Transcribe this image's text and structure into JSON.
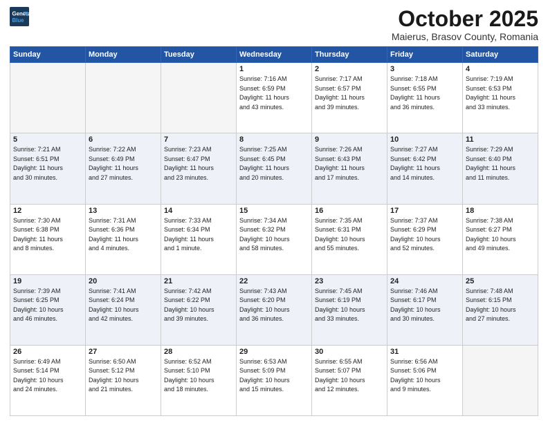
{
  "header": {
    "logo_line1": "General",
    "logo_line2": "Blue",
    "month": "October 2025",
    "location": "Maierus, Brasov County, Romania"
  },
  "weekdays": [
    "Sunday",
    "Monday",
    "Tuesday",
    "Wednesday",
    "Thursday",
    "Friday",
    "Saturday"
  ],
  "weeks": [
    [
      {
        "day": "",
        "info": ""
      },
      {
        "day": "",
        "info": ""
      },
      {
        "day": "",
        "info": ""
      },
      {
        "day": "1",
        "info": "Sunrise: 7:16 AM\nSunset: 6:59 PM\nDaylight: 11 hours\nand 43 minutes."
      },
      {
        "day": "2",
        "info": "Sunrise: 7:17 AM\nSunset: 6:57 PM\nDaylight: 11 hours\nand 39 minutes."
      },
      {
        "day": "3",
        "info": "Sunrise: 7:18 AM\nSunset: 6:55 PM\nDaylight: 11 hours\nand 36 minutes."
      },
      {
        "day": "4",
        "info": "Sunrise: 7:19 AM\nSunset: 6:53 PM\nDaylight: 11 hours\nand 33 minutes."
      }
    ],
    [
      {
        "day": "5",
        "info": "Sunrise: 7:21 AM\nSunset: 6:51 PM\nDaylight: 11 hours\nand 30 minutes."
      },
      {
        "day": "6",
        "info": "Sunrise: 7:22 AM\nSunset: 6:49 PM\nDaylight: 11 hours\nand 27 minutes."
      },
      {
        "day": "7",
        "info": "Sunrise: 7:23 AM\nSunset: 6:47 PM\nDaylight: 11 hours\nand 23 minutes."
      },
      {
        "day": "8",
        "info": "Sunrise: 7:25 AM\nSunset: 6:45 PM\nDaylight: 11 hours\nand 20 minutes."
      },
      {
        "day": "9",
        "info": "Sunrise: 7:26 AM\nSunset: 6:43 PM\nDaylight: 11 hours\nand 17 minutes."
      },
      {
        "day": "10",
        "info": "Sunrise: 7:27 AM\nSunset: 6:42 PM\nDaylight: 11 hours\nand 14 minutes."
      },
      {
        "day": "11",
        "info": "Sunrise: 7:29 AM\nSunset: 6:40 PM\nDaylight: 11 hours\nand 11 minutes."
      }
    ],
    [
      {
        "day": "12",
        "info": "Sunrise: 7:30 AM\nSunset: 6:38 PM\nDaylight: 11 hours\nand 8 minutes."
      },
      {
        "day": "13",
        "info": "Sunrise: 7:31 AM\nSunset: 6:36 PM\nDaylight: 11 hours\nand 4 minutes."
      },
      {
        "day": "14",
        "info": "Sunrise: 7:33 AM\nSunset: 6:34 PM\nDaylight: 11 hours\nand 1 minute."
      },
      {
        "day": "15",
        "info": "Sunrise: 7:34 AM\nSunset: 6:32 PM\nDaylight: 10 hours\nand 58 minutes."
      },
      {
        "day": "16",
        "info": "Sunrise: 7:35 AM\nSunset: 6:31 PM\nDaylight: 10 hours\nand 55 minutes."
      },
      {
        "day": "17",
        "info": "Sunrise: 7:37 AM\nSunset: 6:29 PM\nDaylight: 10 hours\nand 52 minutes."
      },
      {
        "day": "18",
        "info": "Sunrise: 7:38 AM\nSunset: 6:27 PM\nDaylight: 10 hours\nand 49 minutes."
      }
    ],
    [
      {
        "day": "19",
        "info": "Sunrise: 7:39 AM\nSunset: 6:25 PM\nDaylight: 10 hours\nand 46 minutes."
      },
      {
        "day": "20",
        "info": "Sunrise: 7:41 AM\nSunset: 6:24 PM\nDaylight: 10 hours\nand 42 minutes."
      },
      {
        "day": "21",
        "info": "Sunrise: 7:42 AM\nSunset: 6:22 PM\nDaylight: 10 hours\nand 39 minutes."
      },
      {
        "day": "22",
        "info": "Sunrise: 7:43 AM\nSunset: 6:20 PM\nDaylight: 10 hours\nand 36 minutes."
      },
      {
        "day": "23",
        "info": "Sunrise: 7:45 AM\nSunset: 6:19 PM\nDaylight: 10 hours\nand 33 minutes."
      },
      {
        "day": "24",
        "info": "Sunrise: 7:46 AM\nSunset: 6:17 PM\nDaylight: 10 hours\nand 30 minutes."
      },
      {
        "day": "25",
        "info": "Sunrise: 7:48 AM\nSunset: 6:15 PM\nDaylight: 10 hours\nand 27 minutes."
      }
    ],
    [
      {
        "day": "26",
        "info": "Sunrise: 6:49 AM\nSunset: 5:14 PM\nDaylight: 10 hours\nand 24 minutes."
      },
      {
        "day": "27",
        "info": "Sunrise: 6:50 AM\nSunset: 5:12 PM\nDaylight: 10 hours\nand 21 minutes."
      },
      {
        "day": "28",
        "info": "Sunrise: 6:52 AM\nSunset: 5:10 PM\nDaylight: 10 hours\nand 18 minutes."
      },
      {
        "day": "29",
        "info": "Sunrise: 6:53 AM\nSunset: 5:09 PM\nDaylight: 10 hours\nand 15 minutes."
      },
      {
        "day": "30",
        "info": "Sunrise: 6:55 AM\nSunset: 5:07 PM\nDaylight: 10 hours\nand 12 minutes."
      },
      {
        "day": "31",
        "info": "Sunrise: 6:56 AM\nSunset: 5:06 PM\nDaylight: 10 hours\nand 9 minutes."
      },
      {
        "day": "",
        "info": ""
      }
    ]
  ]
}
